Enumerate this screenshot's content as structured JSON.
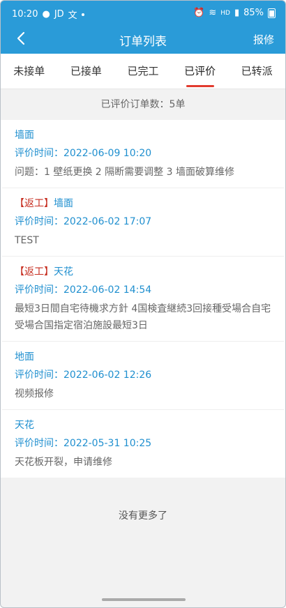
{
  "status": {
    "time": "10:20",
    "carrier": "JD",
    "extra": "文",
    "signal": "HD",
    "battery": "85%"
  },
  "nav": {
    "title": "订单列表",
    "action": "报修"
  },
  "tabs": [
    {
      "label": "未接单"
    },
    {
      "label": "已接单"
    },
    {
      "label": "已完工"
    },
    {
      "label": "已评价",
      "active": true
    },
    {
      "label": "已转派"
    }
  ],
  "summary": "已评价订单数：5单",
  "orders": [
    {
      "prefix": "",
      "title": "墙面",
      "time_label": "评价时间：",
      "time": "2022-06-09 10:20",
      "desc": "问题：1 壁纸更换 2 隔断需要调整 3 墙面破算维修"
    },
    {
      "prefix": "【返工】",
      "title": "墙面",
      "time_label": "评价时间：",
      "time": "2022-06-02 17:07",
      "desc": "TEST"
    },
    {
      "prefix": "【返工】",
      "title": "天花",
      "time_label": "评价时间：",
      "time": "2022-06-02 14:54",
      "desc": "最短3日間自宅待機求方針 4国検査継続3回接種受場合自宅受場合国指定宿泊施設最短3日"
    },
    {
      "prefix": "",
      "title": "地面",
      "time_label": "评价时间：",
      "time": "2022-06-02 12:26",
      "desc": "视频报修"
    },
    {
      "prefix": "",
      "title": "天花",
      "time_label": "评价时间：",
      "time": "2022-05-31 10:25",
      "desc": "天花板开裂，申请维修"
    }
  ],
  "footer": "没有更多了",
  "colors": {
    "primary": "#2a9bd8",
    "accent": "#e23b2e",
    "rework": "#c62d1f",
    "link": "#1f8fcf"
  }
}
